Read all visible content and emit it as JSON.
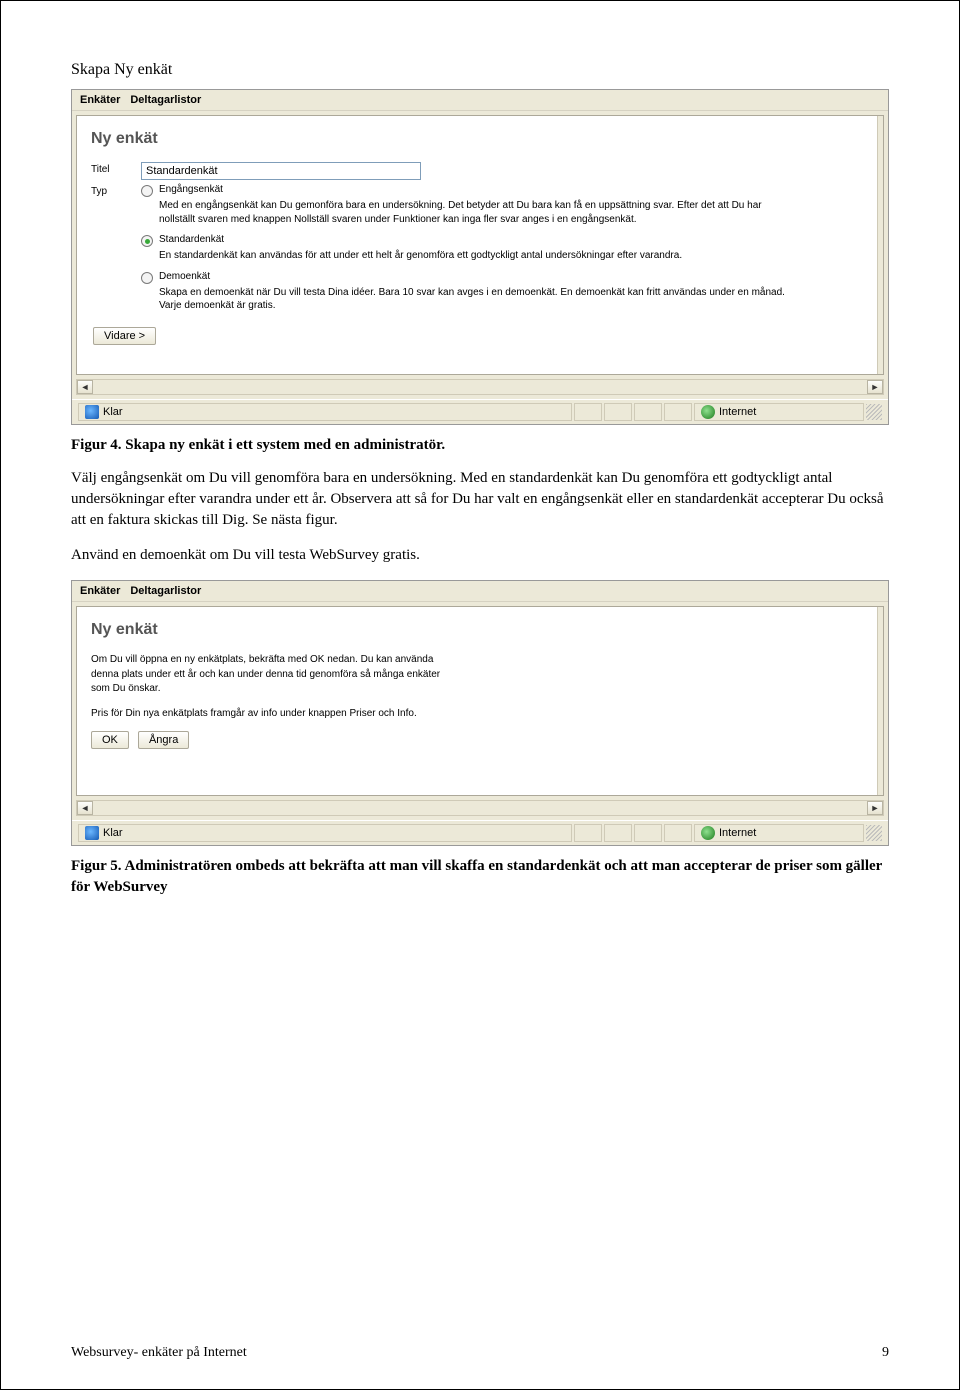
{
  "page": {
    "title": "Skapa Ny enkät",
    "fig4_caption": "Figur 4. Skapa ny enkät i ett system med en administratör.",
    "body1": "Välj engångsenkät om Du vill genomföra bara en undersökning. Med en standardenkät kan Du genomföra ett godtyckligt antal undersökningar efter varandra under ett år. Observera att så for Du har valt en engångsenkät eller en standardenkät accepterar Du också att en faktura skickas till Dig. Se nästa figur.",
    "body2": "Använd en demoenkät om Du vill testa WebSurvey gratis.",
    "fig5_caption": "Figur 5. Administratören ombeds att bekräfta att man vill skaffa en standardenkät och att man accepterar de priser som gäller för WebSurvey",
    "footer_left": "Websurvey- enkäter på Internet",
    "footer_right": "9"
  },
  "shot1": {
    "menubar": {
      "enkater": "Enkäter",
      "deltagarlistor": "Deltagarlistor"
    },
    "heading": "Ny enkät",
    "label_titel": "Titel",
    "label_typ": "Typ",
    "input_titel": "Standardenkät",
    "opt1": {
      "label": "Engångsenkät",
      "desc": "Med en engångsenkät kan Du gemonföra bara en undersökning. Det betyder att Du bara kan få en uppsättning svar. Efter det att Du har nollställt svaren med knappen Nollställ svaren under Funktioner kan inga fler svar anges i en engångsenkät."
    },
    "opt2": {
      "label": "Standardenkät",
      "desc": "En standardenkät kan användas för att under ett helt år genomföra ett godtyckligt antal undersökningar efter varandra."
    },
    "opt3": {
      "label": "Demoenkät",
      "desc": "Skapa en demoenkät när Du vill testa Dina idéer. Bara 10 svar kan avges i en demoenkät. En demoenkät kan fritt användas under en månad. Varje demoenkät är gratis."
    },
    "btn_vidare": "Vidare >",
    "status_klar": "Klar",
    "status_internet": "Internet"
  },
  "shot2": {
    "menubar": {
      "enkater": "Enkäter",
      "deltagarlistor": "Deltagarlistor"
    },
    "heading": "Ny enkät",
    "p1": "Om Du vill öppna en ny enkätplats, bekräfta med OK nedan. Du kan använda denna plats under ett år och kan under denna tid genomföra så många enkäter som Du önskar.",
    "p2": "Pris för Din nya enkätplats framgår av info under knappen Priser och Info.",
    "btn_ok": "OK",
    "btn_angra": "Ångra",
    "status_klar": "Klar",
    "status_internet": "Internet"
  }
}
